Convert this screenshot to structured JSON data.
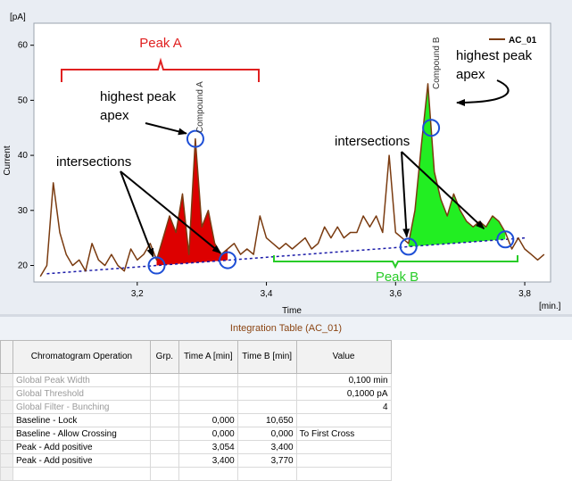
{
  "chart": {
    "y_unit": "[pA]",
    "ylabel": "Current",
    "xlabel": "Time",
    "x_unit": "[min.]",
    "legend": "AC_01",
    "y_ticks": [
      "60",
      "50",
      "40",
      "30",
      "20"
    ],
    "x_ticks": [
      "3,2",
      "3,4",
      "3,6",
      "3,8"
    ]
  },
  "annotations": {
    "peak_a": "Peak A",
    "peak_b": "Peak B",
    "apex_a_line1": "highest peak",
    "apex_a_line2": "apex",
    "apex_b_line1": "highest peak",
    "apex_b_line2": "apex",
    "intersections_left": "intersections",
    "intersections_right": "intersections",
    "compound_a": "Compound A",
    "compound_b": "Compound B"
  },
  "colors": {
    "trace": "#7a3b10",
    "peak_a_fill": "#dd0000",
    "peak_b_fill": "#22ee22",
    "baseline": "#1a1aa8",
    "circle": "#1e4fd6",
    "peak_a_label": "#e02020",
    "peak_b_label": "#28cc28"
  },
  "chart_data": {
    "type": "line",
    "x": [
      3.05,
      3.06,
      3.07,
      3.08,
      3.09,
      3.1,
      3.11,
      3.12,
      3.13,
      3.14,
      3.15,
      3.16,
      3.17,
      3.18,
      3.19,
      3.2,
      3.21,
      3.22,
      3.23,
      3.24,
      3.25,
      3.26,
      3.27,
      3.28,
      3.29,
      3.3,
      3.31,
      3.32,
      3.33,
      3.34,
      3.35,
      3.36,
      3.37,
      3.38,
      3.39,
      3.4,
      3.41,
      3.42,
      3.43,
      3.44,
      3.45,
      3.46,
      3.47,
      3.48,
      3.49,
      3.5,
      3.51,
      3.52,
      3.53,
      3.54,
      3.55,
      3.56,
      3.57,
      3.58,
      3.59,
      3.6,
      3.61,
      3.62,
      3.63,
      3.64,
      3.65,
      3.66,
      3.67,
      3.68,
      3.69,
      3.7,
      3.71,
      3.72,
      3.73,
      3.74,
      3.75,
      3.76,
      3.77,
      3.78,
      3.79,
      3.8,
      3.81,
      3.82,
      3.83
    ],
    "series": [
      {
        "name": "AC_01",
        "values": [
          18,
          20,
          35,
          26,
          22,
          20,
          21,
          19,
          24,
          21,
          20,
          22,
          20,
          19,
          23,
          21,
          22,
          24,
          21,
          25,
          29,
          26,
          33,
          22,
          43,
          27,
          30,
          24,
          22,
          23,
          24,
          22,
          23,
          22,
          29,
          25,
          24,
          23,
          24,
          23,
          24,
          25,
          23,
          24,
          27,
          25,
          27,
          25,
          26,
          26,
          29,
          27,
          29,
          26,
          40,
          26,
          25,
          24,
          30,
          42,
          53,
          37,
          32,
          29,
          33,
          30,
          28,
          27,
          28,
          27,
          29,
          28,
          26,
          23,
          25,
          23,
          22,
          21,
          22
        ]
      }
    ],
    "ylim": [
      17,
      64
    ],
    "xlim": [
      3.04,
      3.84
    ],
    "legend": "top-right",
    "grid": false,
    "peaks": [
      {
        "name": "Compound A",
        "start": 3.23,
        "end": 3.34,
        "apex": 3.29
      },
      {
        "name": "Compound B",
        "start": 3.62,
        "end": 3.77,
        "apex": 3.655
      }
    ],
    "baseline": {
      "start": [
        3.06,
        18.5
      ],
      "end": [
        3.8,
        25
      ]
    }
  },
  "table": {
    "title": "Integration Table (AC_01)",
    "headers": [
      "Chromatogram Operation",
      "Grp.",
      "Time A [min]",
      "Time B [min]",
      "Value"
    ],
    "rows": [
      {
        "op": "Global Peak Width",
        "grp": "",
        "ta": "",
        "tb": "",
        "value": "0,100 min",
        "global": true
      },
      {
        "op": "Global Threshold",
        "grp": "",
        "ta": "",
        "tb": "",
        "value": "0,1000 pA",
        "global": true
      },
      {
        "op": "Global Filter - Bunching",
        "grp": "",
        "ta": "",
        "tb": "",
        "value": "4",
        "global": true
      },
      {
        "op": "Baseline - Lock",
        "grp": "",
        "ta": "0,000",
        "tb": "10,650",
        "value": "",
        "global": false
      },
      {
        "op": "Baseline - Allow Crossing",
        "grp": "",
        "ta": "0,000",
        "tb": "0,000",
        "value": "To First Cross",
        "global": false
      },
      {
        "op": "Peak - Add positive",
        "grp": "",
        "ta": "3,054",
        "tb": "3,400",
        "value": "",
        "global": false
      },
      {
        "op": "Peak - Add positive",
        "grp": "",
        "ta": "3,400",
        "tb": "3,770",
        "value": "",
        "global": false
      },
      {
        "op": "",
        "grp": "",
        "ta": "",
        "tb": "",
        "value": "",
        "global": false
      }
    ]
  }
}
